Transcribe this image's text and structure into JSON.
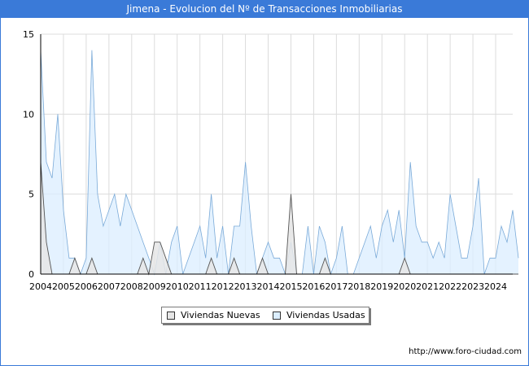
{
  "header": {
    "title": "Jimena - Evolucion del Nº de Transacciones Inmobiliarias"
  },
  "footer": {
    "url": "http://www.foro-ciudad.com"
  },
  "colors": {
    "title_bg": "#3a7ad8",
    "usadas_fill": "#dbeeff",
    "usadas_line": "#7aaad8",
    "nuevas_fill": "#e6e6e6",
    "nuevas_line": "#555555",
    "grid": "#dcdcdc"
  },
  "chart_data": {
    "type": "area",
    "title": "Jimena - Evolucion del Nº de Transacciones Inmobiliarias",
    "xlabel": "",
    "ylabel": "",
    "x_range": [
      2004,
      2024.75
    ],
    "ylim": [
      0,
      15
    ],
    "y_ticks": [
      0,
      5,
      10,
      15
    ],
    "x_ticks": [
      "2004",
      "2005",
      "2006",
      "2007",
      "2008",
      "2009",
      "2010",
      "2011",
      "2012",
      "2013",
      "2014",
      "2015",
      "2016",
      "2017",
      "2018",
      "2019",
      "2020",
      "2021",
      "2022",
      "2023",
      "2024"
    ],
    "grid": true,
    "legend_position": "bottom",
    "x_step": 0.25,
    "series": [
      {
        "name": "Viviendas Usadas",
        "values": [
          14,
          7,
          6,
          10,
          4,
          1,
          1,
          0,
          1,
          14,
          5,
          3,
          4,
          5,
          3,
          5,
          4,
          3,
          2,
          1,
          0,
          2,
          0,
          2,
          3,
          0,
          1,
          2,
          3,
          1,
          5,
          1,
          3,
          0,
          3,
          3,
          7,
          3,
          0,
          1,
          2,
          1,
          1,
          0,
          2,
          0,
          0,
          3,
          0,
          3,
          2,
          0,
          1,
          3,
          0,
          0,
          1,
          2,
          3,
          1,
          3,
          4,
          2,
          4,
          1,
          7,
          3,
          2,
          2,
          1,
          2,
          1,
          5,
          3,
          1,
          1,
          3,
          6,
          0,
          1,
          1,
          3,
          2,
          4,
          1
        ]
      },
      {
        "name": "Viviendas Nuevas",
        "values": [
          7,
          2,
          0,
          0,
          0,
          0,
          1,
          0,
          0,
          1,
          0,
          0,
          0,
          0,
          0,
          0,
          0,
          0,
          1,
          0,
          2,
          2,
          1,
          0,
          0,
          0,
          0,
          0,
          0,
          0,
          1,
          0,
          0,
          0,
          1,
          0,
          0,
          0,
          0,
          1,
          0,
          0,
          0,
          0,
          5,
          0,
          0,
          0,
          0,
          0,
          1,
          0,
          0,
          0,
          0,
          0,
          0,
          0,
          0,
          0,
          0,
          0,
          0,
          0,
          1,
          0,
          0,
          0,
          0,
          0,
          0,
          0,
          0,
          0,
          0,
          0,
          0,
          0,
          0,
          0,
          0,
          0,
          0,
          0,
          0
        ]
      }
    ]
  }
}
